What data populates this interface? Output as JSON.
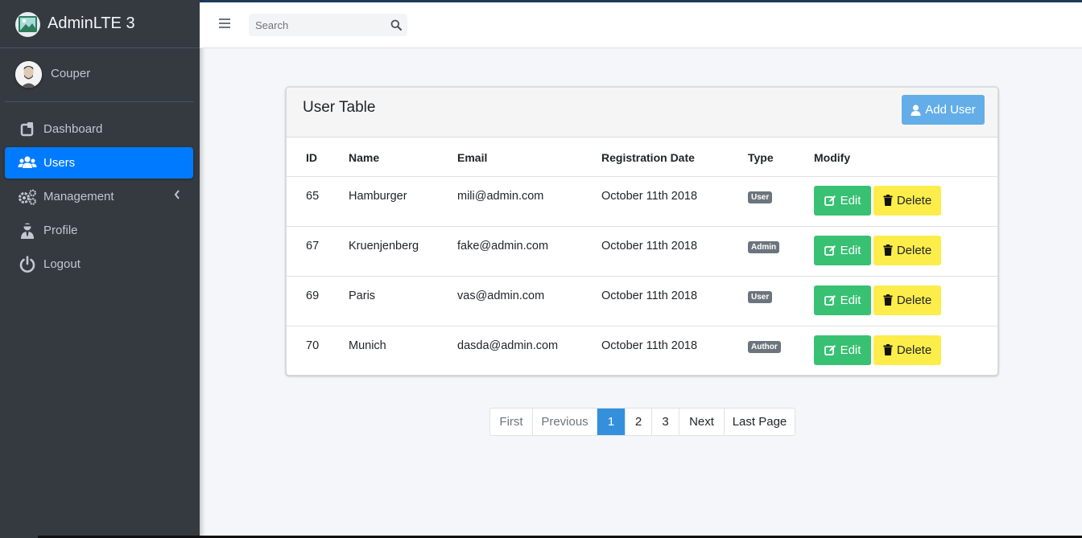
{
  "brand": {
    "title": "AdminLTE 3"
  },
  "user": {
    "name": "Couper"
  },
  "sidebar": {
    "items": [
      {
        "label": "Dashboard",
        "icon": "dashboard-icon",
        "active": false
      },
      {
        "label": "Users",
        "icon": "users-icon",
        "active": true
      },
      {
        "label": "Management",
        "icon": "cogs-icon",
        "active": false
      },
      {
        "label": "Profile",
        "icon": "user-tie-icon",
        "active": false
      },
      {
        "label": "Logout",
        "icon": "power-off-icon",
        "active": false
      }
    ]
  },
  "search": {
    "placeholder": "Search"
  },
  "card": {
    "title": "User Table",
    "add_button": "Add User",
    "columns": [
      "ID",
      "Name",
      "Email",
      "Registration Date",
      "Type",
      "Modify"
    ],
    "rows": [
      {
        "id": "65",
        "name": "Hamburger",
        "email": "mili@admin.com",
        "date": "October 11th 2018",
        "type": "User"
      },
      {
        "id": "67",
        "name": "Kruenjenberg",
        "email": "fake@admin.com",
        "date": "October 11th 2018",
        "type": "Admin"
      },
      {
        "id": "69",
        "name": "Paris",
        "email": "vas@admin.com",
        "date": "October 11th 2018",
        "type": "User"
      },
      {
        "id": "70",
        "name": "Munich",
        "email": "dasda@admin.com",
        "date": "October 11th 2018",
        "type": "Author"
      }
    ],
    "edit_label": "Edit",
    "delete_label": "Delete"
  },
  "pagination": {
    "first": "First",
    "previous": "Previous",
    "pages": [
      "1",
      "2",
      "3"
    ],
    "current": "1",
    "next": "Next",
    "last": "Last Page"
  },
  "colors": {
    "sidebar_bg": "#343a40",
    "active": "#007bff",
    "add_button": "#63aee8",
    "edit": "#38c172",
    "delete": "#fced4a",
    "page_active": "#3490dc",
    "badge": "#6c757d"
  }
}
